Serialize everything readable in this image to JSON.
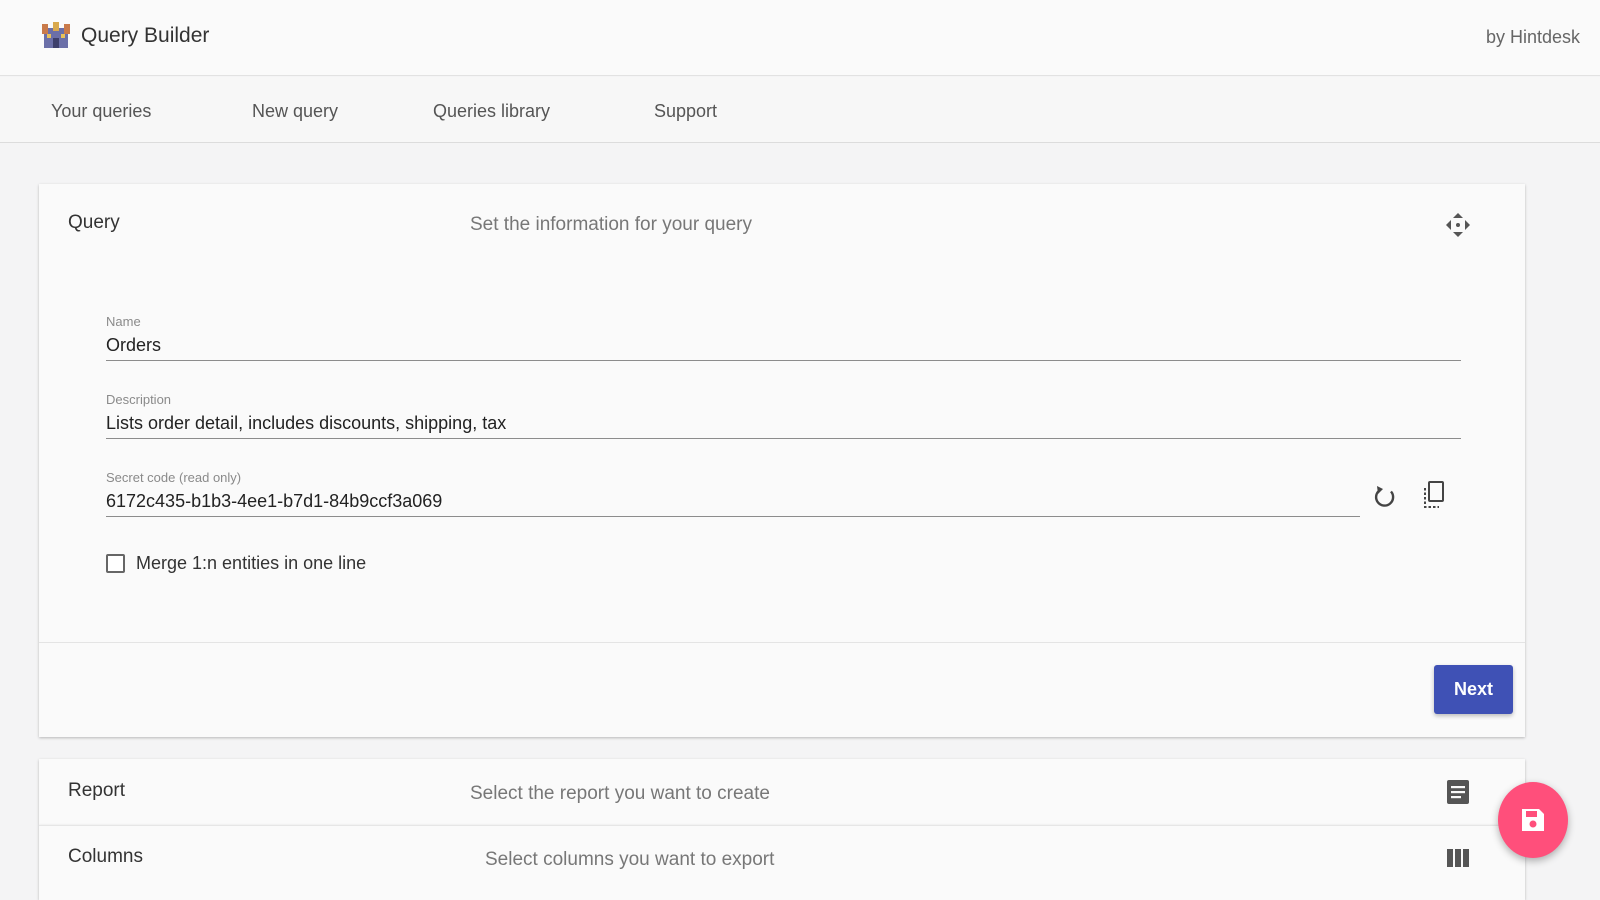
{
  "app": {
    "title": "Query Builder",
    "byline": "by Hintdesk",
    "logo_icon": "castle-logo-icon"
  },
  "nav": {
    "items": [
      {
        "label": "Your queries"
      },
      {
        "label": "New query"
      },
      {
        "label": "Queries library"
      },
      {
        "label": "Support"
      }
    ]
  },
  "steps": {
    "query": {
      "title": "Query",
      "description": "Set the information for your query",
      "icon": "drag-move-icon"
    },
    "report": {
      "title": "Report",
      "description": "Select the report you want to create",
      "icon": "document-icon"
    },
    "columns": {
      "title": "Columns",
      "description": "Select columns you want to export",
      "icon": "columns-icon"
    }
  },
  "form": {
    "name": {
      "label": "Name",
      "value": "Orders"
    },
    "description": {
      "label": "Description",
      "value": "Lists order detail, includes discounts, shipping, tax"
    },
    "secret": {
      "label": "Secret code (read only)",
      "value": "6172c435-b1b3-4ee1-b7d1-84b9ccf3a069"
    },
    "merge": {
      "label": "Merge 1:n entities in one line",
      "checked": false
    }
  },
  "actions": {
    "next_label": "Next",
    "refresh_icon": "refresh-icon",
    "copy_icon": "copy-icon",
    "save_icon": "save-icon"
  },
  "colors": {
    "primary": "#3f51b5",
    "fab": "#ff4f7b"
  }
}
